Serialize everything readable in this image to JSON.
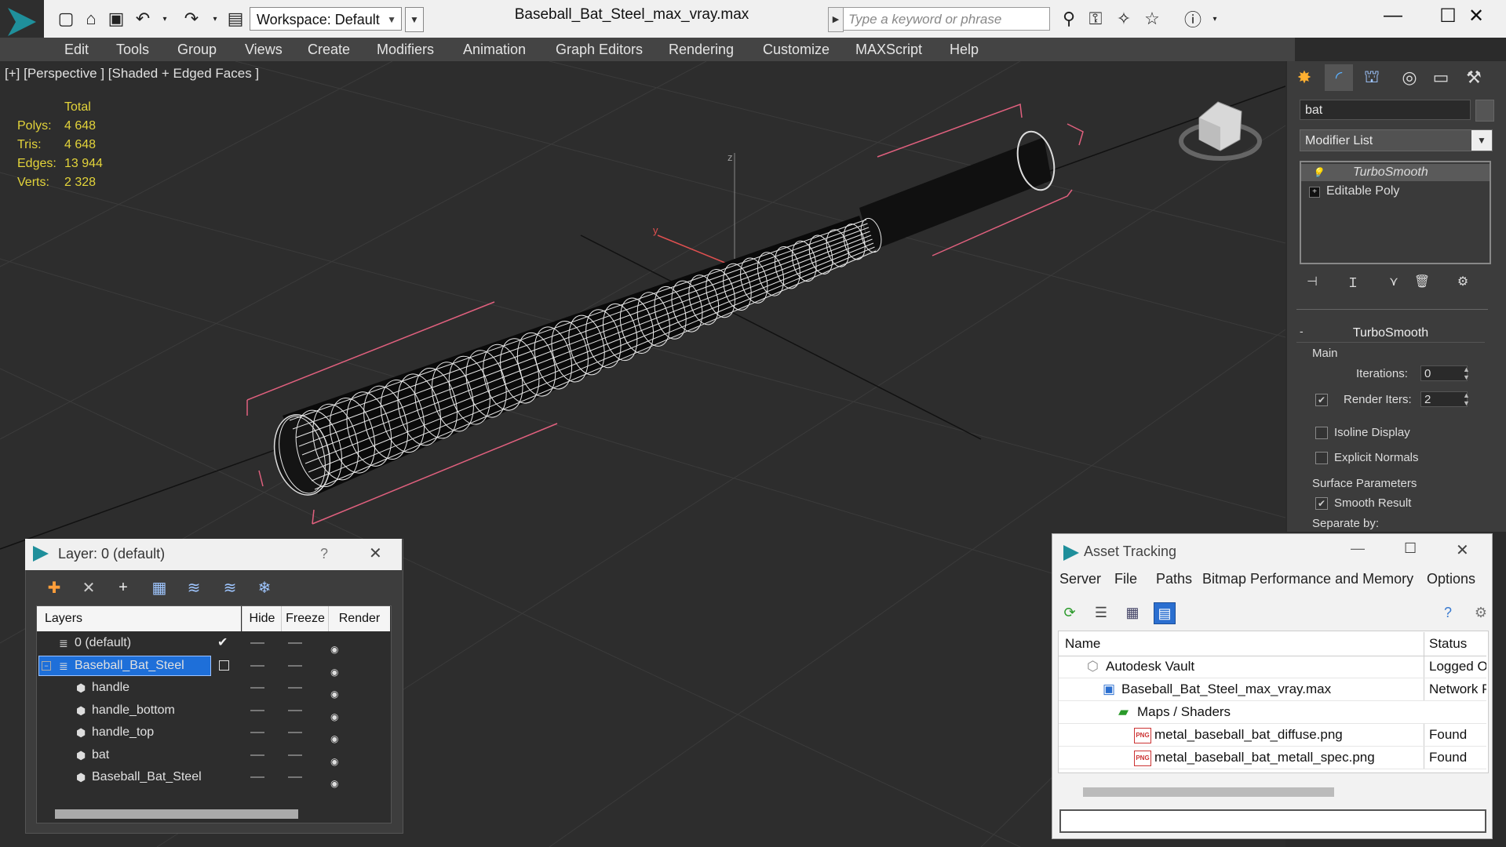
{
  "window": {
    "title": "Baseball_Bat_Steel_max_vray.max",
    "workspace_label": "Workspace: Default",
    "search_placeholder": "Type a keyword or phrase"
  },
  "menu": [
    "Edit",
    "Tools",
    "Group",
    "Views",
    "Create",
    "Modifiers",
    "Animation",
    "Graph Editors",
    "Rendering",
    "Customize",
    "MAXScript",
    "Help"
  ],
  "viewport": {
    "label": "[+] [Perspective ] [Shaded + Edged Faces ]",
    "stats_header": "Total",
    "stats": [
      {
        "label": "Polys:",
        "value": "4 648"
      },
      {
        "label": "Tris:",
        "value": "4 648"
      },
      {
        "label": "Edges:",
        "value": "13 944"
      },
      {
        "label": "Verts:",
        "value": "2 328"
      }
    ],
    "axis_labels": {
      "y": "y",
      "z": "z"
    }
  },
  "command_panel": {
    "object_name": "bat",
    "modifier_list_label": "Modifier List",
    "stack": [
      "TurboSmooth",
      "Editable Poly"
    ],
    "rollout_title": "TurboSmooth",
    "main_label": "Main",
    "iterations_label": "Iterations:",
    "iterations_value": "0",
    "render_iters_label": "Render Iters:",
    "render_iters_value": "2",
    "render_iters_checked": true,
    "isoline_label": "Isoline Display",
    "isoline_checked": false,
    "explicit_normals_label": "Explicit Normals",
    "explicit_normals_checked": false,
    "surface_params_label": "Surface Parameters",
    "smooth_result_label": "Smooth Result",
    "smooth_result_checked": true,
    "separate_by_label": "Separate by:"
  },
  "layer_panel": {
    "title": "Layer: 0 (default)",
    "help": "?",
    "columns": {
      "layers": "Layers",
      "hide": "Hide",
      "freeze": "Freeze",
      "render": "Render"
    },
    "rows": [
      {
        "name": "0 (default)",
        "indent": 0,
        "active": true,
        "selected": false
      },
      {
        "name": "Baseball_Bat_Steel",
        "indent": 0,
        "active": false,
        "selected": true
      },
      {
        "name": "handle",
        "indent": 1,
        "active": false,
        "selected": false
      },
      {
        "name": "handle_bottom",
        "indent": 1,
        "active": false,
        "selected": false
      },
      {
        "name": "handle_top",
        "indent": 1,
        "active": false,
        "selected": false
      },
      {
        "name": "bat",
        "indent": 1,
        "active": false,
        "selected": false
      },
      {
        "name": "Baseball_Bat_Steel",
        "indent": 1,
        "active": false,
        "selected": false
      }
    ]
  },
  "asset_tracking": {
    "title": "Asset Tracking",
    "menu": [
      "Server",
      "File",
      "Paths",
      "Bitmap Performance and Memory",
      "Options"
    ],
    "columns": {
      "name": "Name",
      "status": "Status"
    },
    "rows": [
      {
        "name": "Autodesk Vault",
        "status": "Logged Ou",
        "level": 0,
        "icon": "vault-icon"
      },
      {
        "name": "Baseball_Bat_Steel_max_vray.max",
        "status": "Network Pa",
        "level": 1,
        "icon": "max-file-icon"
      },
      {
        "name": "Maps / Shaders",
        "status": "",
        "level": 2,
        "icon": "maps-icon"
      },
      {
        "name": "metal_baseball_bat_diffuse.png",
        "status": "Found",
        "level": 3,
        "icon": "png-icon"
      },
      {
        "name": "metal_baseball_bat_metall_spec.png",
        "status": "Found",
        "level": 3,
        "icon": "png-icon"
      }
    ]
  },
  "colors": {
    "accent": "#1e6fd9",
    "stats_yellow": "#e3d43a",
    "selection_bracket": "#e0607e"
  }
}
